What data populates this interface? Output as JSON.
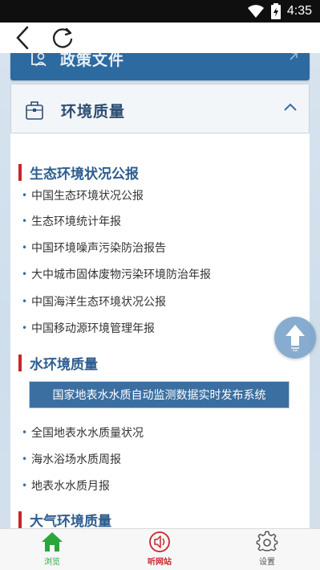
{
  "status_bar": {
    "time": "4:35",
    "icons": [
      "wifi-icon",
      "battery-charging-icon"
    ]
  },
  "nav": {
    "back_icon": "back-arrow-icon",
    "refresh_icon": "refresh-icon"
  },
  "categories": {
    "policy": {
      "label": "政策文件",
      "icon": "document-person-icon"
    },
    "environment": {
      "label": "环境质量",
      "icon": "briefcase-icon",
      "expanded": true
    }
  },
  "sections": [
    {
      "title": "生态环境状况公报",
      "items": [
        "中国生态环境状况公报",
        "生态环境统计年报",
        "中国环境噪声污染防治报告",
        "大中城市固体废物污染环境防治年报",
        "中国海洋生态环境状况公报",
        "中国移动源环境管理年报"
      ]
    },
    {
      "title": "水环境质量",
      "banner": "国家地表水水质自动监测数据实时发布系统",
      "items": [
        "全国地表水水质量状况",
        "海水浴场水质周报",
        "地表水水质月报"
      ]
    },
    {
      "title": "大气环境质量",
      "items": []
    }
  ],
  "tabs": [
    {
      "label": "浏览",
      "icon": "home-icon",
      "active": true,
      "color": "#2ba63b"
    },
    {
      "label": "听网站",
      "icon": "speaker-icon",
      "color": "#c9252a"
    },
    {
      "label": "设置",
      "icon": "gear-icon",
      "color": "#555555"
    }
  ],
  "colors": {
    "accent_blue": "#2c6aa0",
    "section_red": "#c9252a",
    "section_text": "#2e5d8f"
  }
}
